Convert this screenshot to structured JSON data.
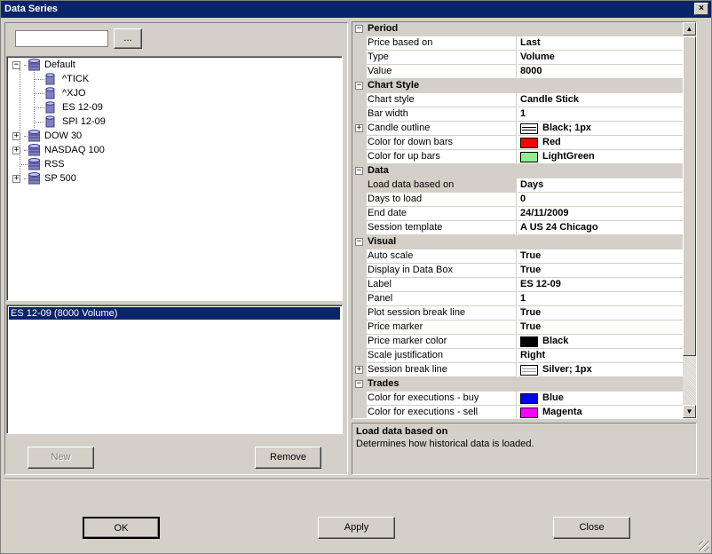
{
  "window": {
    "title": "Data Series",
    "close_glyph": "×"
  },
  "search": {
    "value": "",
    "placeholder": ""
  },
  "browse_label": "...",
  "tree": [
    {
      "label": "Default",
      "expand": "−",
      "children": [
        "^TICK",
        "^XJO",
        "ES 12-09",
        "SPI 12-09"
      ]
    },
    {
      "label": "DOW 30",
      "expand": "+"
    },
    {
      "label": "NASDAQ 100",
      "expand": "+"
    },
    {
      "label": "RSS",
      "expand": ""
    },
    {
      "label": "SP 500",
      "expand": "+"
    }
  ],
  "series_list": {
    "items": [
      "ES 12-09 (8000 Volume)"
    ]
  },
  "buttons": {
    "new": "New",
    "remove": "Remove",
    "ok": "OK",
    "apply": "Apply",
    "close": "Close"
  },
  "properties": {
    "categories": [
      {
        "name": "Period",
        "rows": [
          {
            "name": "Price based on",
            "value": "Last"
          },
          {
            "name": "Type",
            "value": "Volume"
          },
          {
            "name": "Value",
            "value": "8000"
          }
        ]
      },
      {
        "name": "Chart Style",
        "rows": [
          {
            "name": "Chart style",
            "value": "Candle Stick"
          },
          {
            "name": "Bar width",
            "value": "1"
          },
          {
            "name": "Candle outline",
            "value": "Black; 1px"
          },
          {
            "name": "Color for down bars",
            "value": "Red"
          },
          {
            "name": "Color for up bars",
            "value": "LightGreen"
          }
        ]
      },
      {
        "name": "Data",
        "rows": [
          {
            "name": "Load data based on",
            "value": "Days"
          },
          {
            "name": "Days to load",
            "value": "0"
          },
          {
            "name": "End date",
            "value": "24/11/2009"
          },
          {
            "name": "Session template",
            "value": "A US 24 Chicago"
          }
        ]
      },
      {
        "name": "Visual",
        "rows": [
          {
            "name": "Auto scale",
            "value": "True"
          },
          {
            "name": "Display in Data Box",
            "value": "True"
          },
          {
            "name": "Label",
            "value": "ES 12-09"
          },
          {
            "name": "Panel",
            "value": "1"
          },
          {
            "name": "Plot session break line",
            "value": "True"
          },
          {
            "name": "Price marker",
            "value": "True"
          },
          {
            "name": "Price marker color",
            "value": "Black"
          },
          {
            "name": "Scale justification",
            "value": "Right"
          },
          {
            "name": "Session break line",
            "value": "Silver; 1px"
          }
        ]
      },
      {
        "name": "Trades",
        "rows": [
          {
            "name": "Color for executions - buy",
            "value": "Blue"
          },
          {
            "name": "Color for executions - sell",
            "value": "Magenta"
          }
        ]
      }
    ],
    "collapse_glyph": "−",
    "expand_glyph": "+"
  },
  "colors": {
    "titlebar": "#0a246a",
    "black": "#000000",
    "red": "#ff0000",
    "lightgreen": "#90ee90",
    "blue": "#0000ff",
    "magenta": "#ff00ff"
  },
  "description": {
    "title": "Load data based on",
    "text": "Determines how historical data is loaded."
  },
  "scrollbar": {
    "up": "▲",
    "down": "▼"
  }
}
